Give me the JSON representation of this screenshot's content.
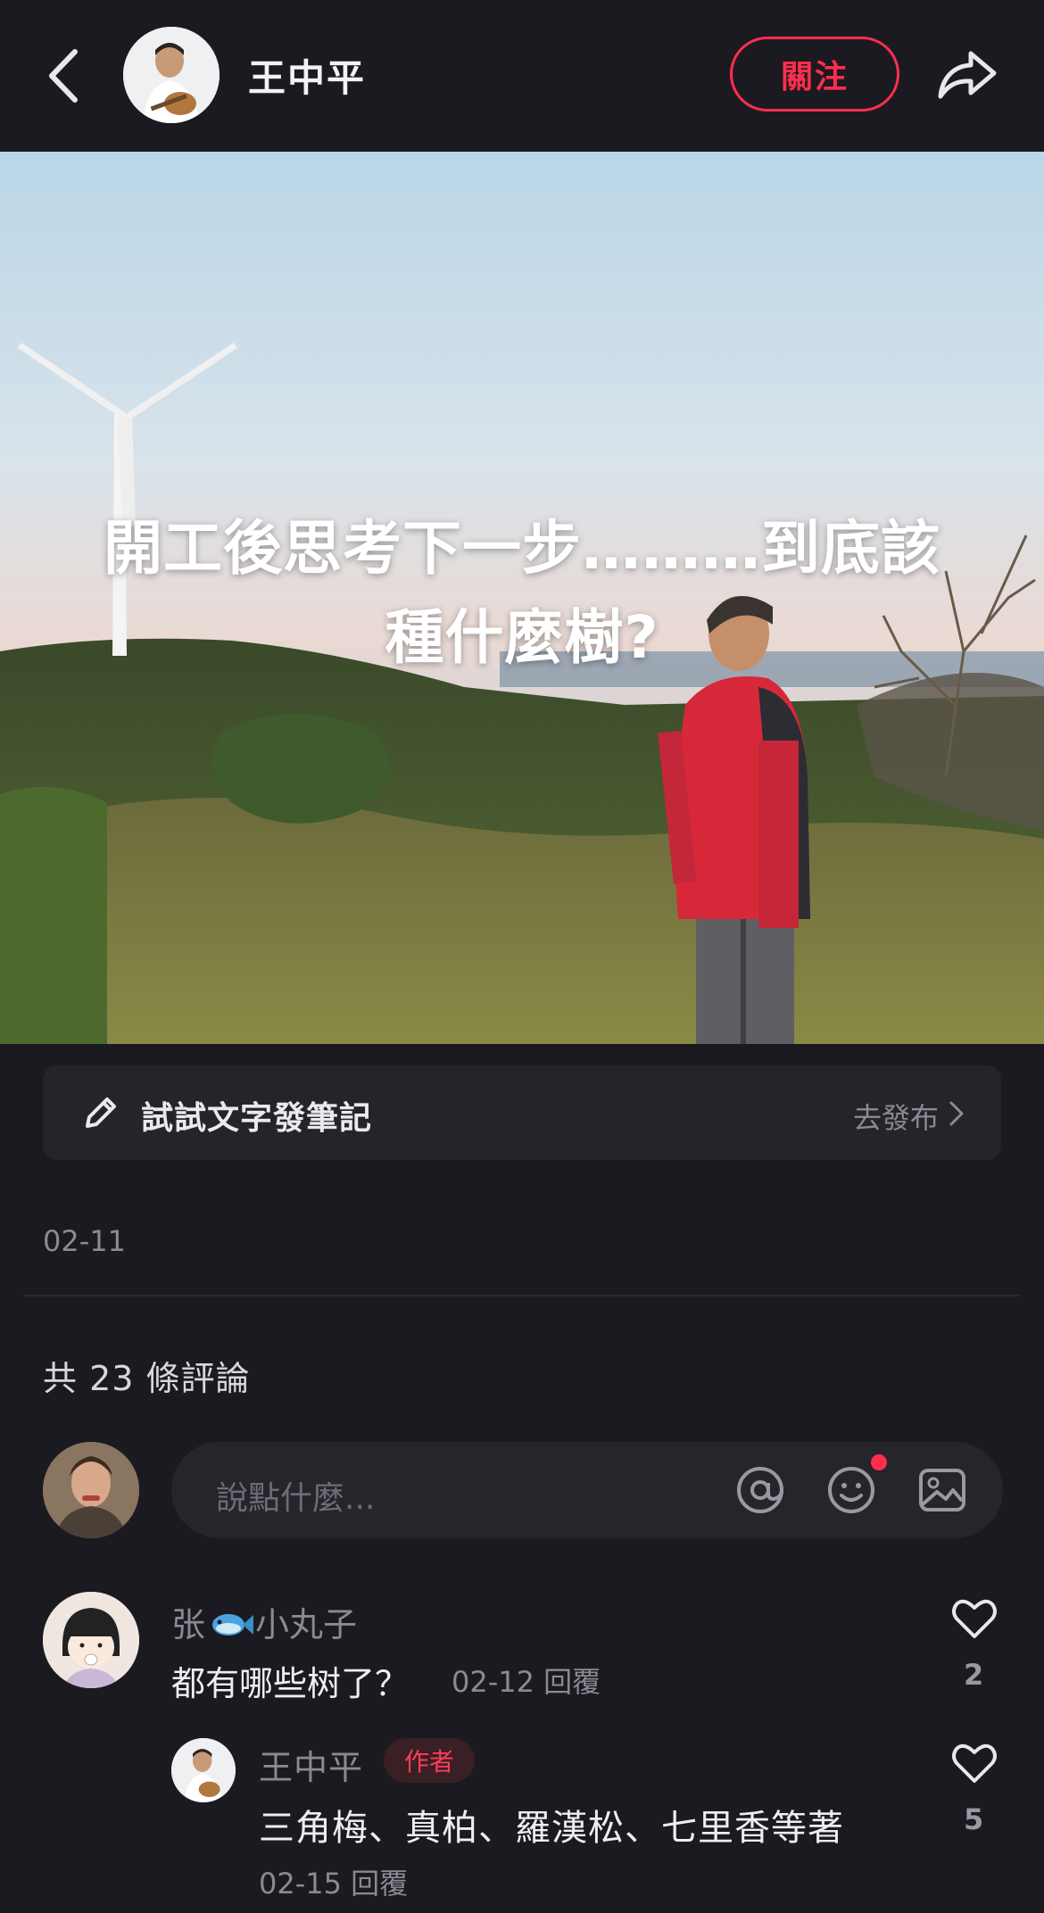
{
  "header": {
    "author_name": "王中平",
    "follow_label": "關注"
  },
  "post": {
    "overlay_title_line1": "開工後思考下一步………到底該",
    "overlay_title_line2": "種什麼樹?",
    "date": "02-11"
  },
  "note_bar": {
    "label": "試試文字發筆記",
    "action": "去發布"
  },
  "comments": {
    "count_label": "共 23 條評論",
    "input_placeholder": "說點什麼...",
    "items": [
      {
        "name_part1": "张",
        "name_part2": "小丸子",
        "name_icon": "fish-emoji-icon",
        "text": "都有哪些树了？",
        "meta": "02-12 回覆",
        "likes": "2",
        "replies": [
          {
            "name": "王中平",
            "badge": "作者",
            "text": "三角梅、真柏、羅漢松、七里香等著",
            "meta": "02-15 回覆",
            "likes": "5"
          }
        ]
      }
    ]
  },
  "icons": {
    "back": "chevron-left-icon",
    "share": "share-arrow-icon",
    "pencil": "pencil-icon",
    "at": "at-icon",
    "emoji": "emoji-icon",
    "image": "image-icon",
    "like": "heart-icon"
  },
  "colors": {
    "accent": "#ff2e4d",
    "background": "#1b1a20",
    "muted_text": "#8b8a92"
  }
}
